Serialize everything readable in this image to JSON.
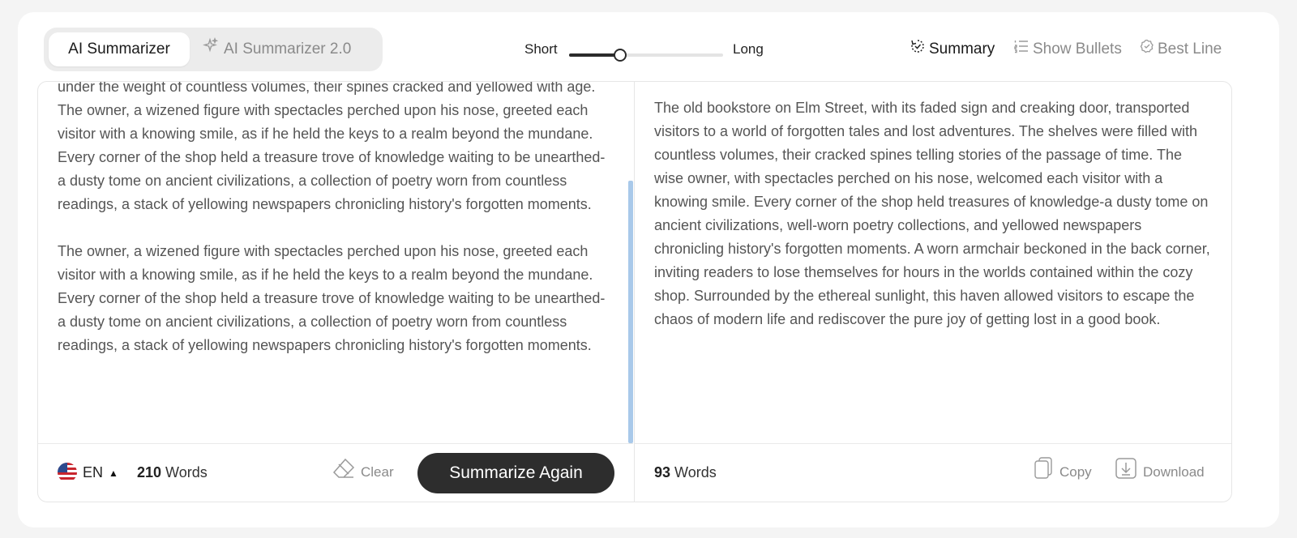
{
  "modes": {
    "tab1": "AI Summarizer",
    "tab2": "AI Summarizer 2.0"
  },
  "length": {
    "short_label": "Short",
    "long_label": "Long",
    "value_fraction": 0.33
  },
  "view_options": {
    "summary": "Summary",
    "bullets": "Show Bullets",
    "best_line": "Best Line"
  },
  "input": {
    "text": "under the weight of countless volumes, their spines cracked and yellowed with age.\nThe owner, a wizened figure with spectacles perched upon his nose, greeted each visitor with a knowing smile, as if he held the keys to a realm beyond the mundane. Every corner of the shop held a treasure trove of knowledge waiting to be unearthed-a dusty tome on ancient civilizations, a collection of poetry worn from countless readings, a stack of yellowing newspapers chronicling history's forgotten moments.\n\nThe owner, a wizened figure with spectacles perched upon his nose, greeted each visitor with a knowing smile, as if he held the keys to a realm beyond the mundane. Every corner of the shop held a treasure trove of knowledge waiting to be unearthed-a dusty tome on ancient civilizations, a collection of poetry worn from countless readings, a stack of yellowing newspapers chronicling history's forgotten moments.",
    "language": "EN",
    "word_count": "210",
    "words_label": "Words",
    "clear_label": "Clear",
    "summarize_label": "Summarize Again"
  },
  "output": {
    "text": "The old bookstore on Elm Street, with its faded sign and creaking door, transported visitors to a world of forgotten tales and lost adventures. The shelves were filled with countless volumes, their cracked spines telling stories of the passage of time. The wise owner, with spectacles perched on his nose, welcomed each visitor with a knowing smile. Every corner of the shop held treasures of knowledge-a dusty tome on ancient civilizations, well-worn poetry collections, and yellowed newspapers chronicling history's forgotten moments. A worn armchair beckoned in the back corner, inviting readers to lose themselves for hours in the worlds contained within the cozy shop. Surrounded by the ethereal sunlight, this haven allowed visitors to escape the chaos of modern life and rediscover the pure joy of getting lost in a good book.",
    "word_count": "93",
    "words_label": "Words",
    "copy_label": "Copy",
    "download_label": "Download"
  },
  "colors": {
    "accent_dark": "#2d2d2d",
    "scrollbar": "#a9c9ea",
    "muted": "#8a8a8a"
  }
}
